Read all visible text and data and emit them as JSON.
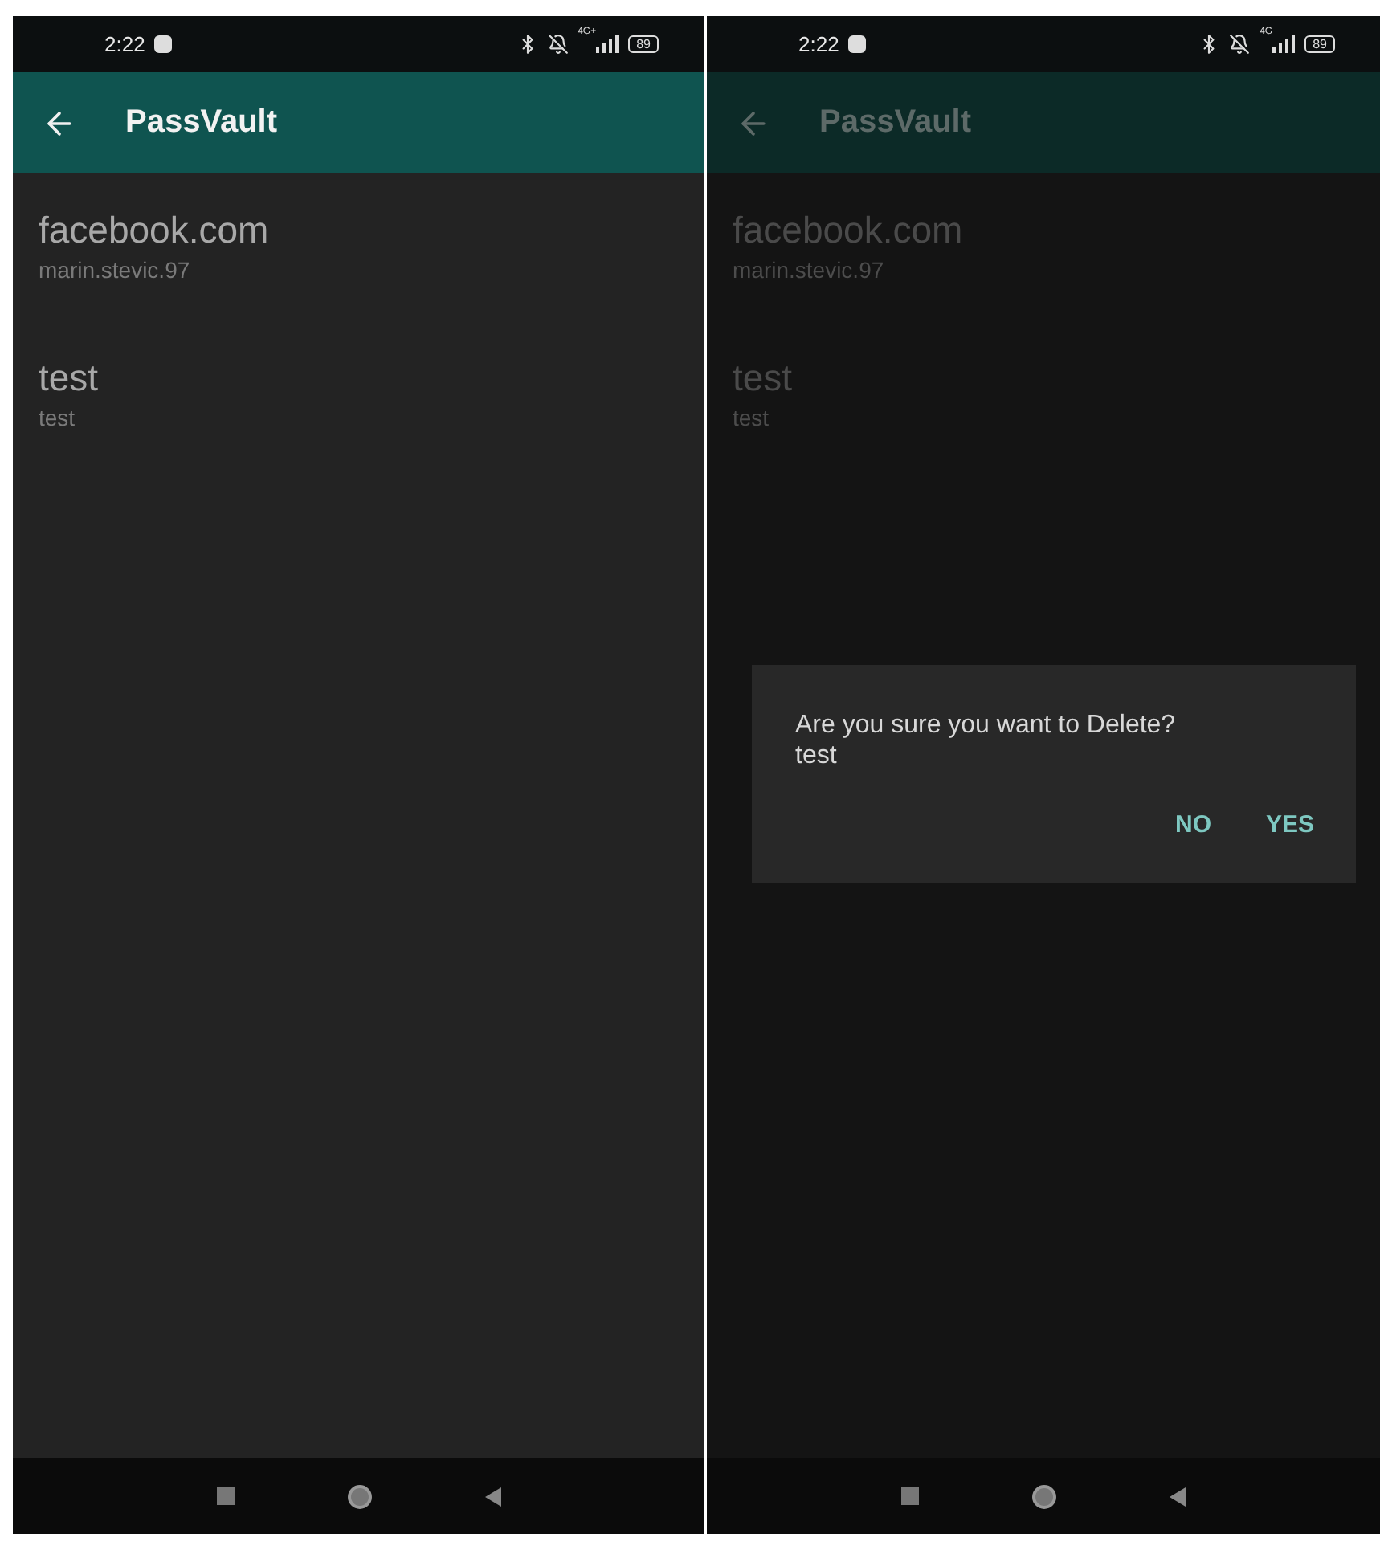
{
  "screens": [
    {
      "status_bar": {
        "time": "2:22",
        "network": "4G+",
        "battery": "89"
      },
      "app_bar": {
        "title": "PassVault"
      },
      "dimmed": false,
      "entries": [
        {
          "site": "facebook.com",
          "username": "marin.stevic.97"
        },
        {
          "site": "test",
          "username": "test"
        }
      ]
    },
    {
      "status_bar": {
        "time": "2:22",
        "network": "4G",
        "battery": "89"
      },
      "app_bar": {
        "title": "PassVault"
      },
      "dimmed": true,
      "entries": [
        {
          "site": "facebook.com",
          "username": "marin.stevic.97"
        },
        {
          "site": "test",
          "username": "test"
        }
      ],
      "dialog": {
        "message": "Are you sure you want to Delete?",
        "item": "test",
        "buttons": [
          "NO",
          "YES"
        ]
      }
    }
  ]
}
